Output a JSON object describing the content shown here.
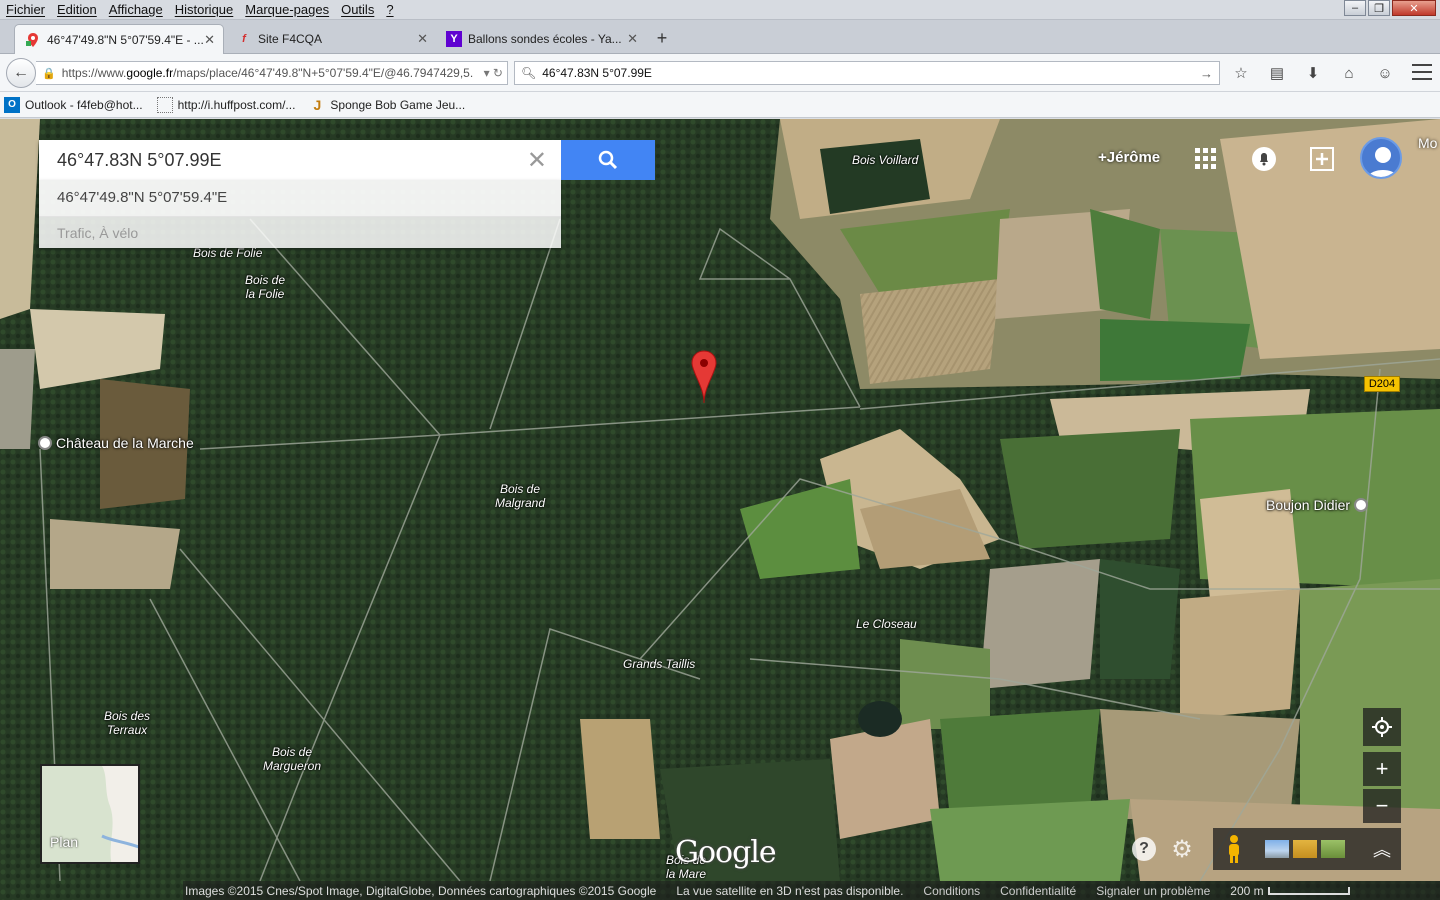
{
  "menubar": {
    "items": [
      "Fichier",
      "Edition",
      "Affichage",
      "Historique",
      "Marque-pages",
      "Outils",
      "?"
    ]
  },
  "tabs": [
    {
      "label": "46°47'49.8\"N 5°07'59.4\"E - ...",
      "icon": "google-maps-icon"
    },
    {
      "label": "Site F4CQA",
      "icon": "free-icon"
    },
    {
      "label": "Ballons sondes écoles - Ya...",
      "icon": "yahoo-icon"
    }
  ],
  "navbar": {
    "url_prefix": "https://www.",
    "url_domain": "google.fr",
    "url_path": "/maps/place/46°47'49.8\"N+5°07'59.4\"E/@46.7947429,5.",
    "search_value": "46°47.83N 5°07.99E"
  },
  "bookmarks": [
    {
      "label": "Outlook - f4feb@hot...",
      "icon": "outlook-icon"
    },
    {
      "label": "http://i.huffpost.com/...",
      "icon": "page-icon"
    },
    {
      "label": "Sponge Bob Game Jeu...",
      "icon": "jeu-icon"
    }
  ],
  "maps": {
    "search_value": "46°47.83N 5°07.99E",
    "suggestion_1": "46°47'49.8\"N 5°07'59.4\"E",
    "suggestion_2": "Trafic, À vélo",
    "account_link": "+Jérôme",
    "truncated_label": "Mo",
    "road_badge": "D204",
    "minimap_label": "Plan",
    "logo_text": "Google",
    "places": {
      "bois_voillard": "Bois Voillard",
      "bois_de_folie": "Bois de Folie",
      "bois_de_la_folie_1": "Bois de",
      "bois_de_la_folie_2": "la Folie",
      "bois_de_malgrand_1": "Bois de",
      "bois_de_malgrand_2": "Malgrand",
      "bois_des_terraux_1": "Bois des",
      "bois_des_terraux_2": "Terraux",
      "bois_de_margueron_1": "Bois de",
      "bois_de_margueron_2": "Margueron",
      "grands_taillis": "Grands Taillis",
      "le_closeau": "Le Closeau",
      "bois_de_la_mare_1": "Bois de",
      "bois_de_la_mare_2": "la Mare",
      "chateau": "Château de la Marche",
      "boujon": "Boujon Didier"
    },
    "footer": {
      "attribution": "Images ©2015 Cnes/Spot Image, DigitalGlobe, Données cartographiques ©2015 Google",
      "notice": "La vue satellite en 3D n'est pas disponible.",
      "conditions": "Conditions",
      "privacy": "Confidentialité",
      "report": "Signaler un problème",
      "scale": "200 m"
    }
  },
  "colors": {
    "forest": "#243522",
    "search_blue": "#4285f4",
    "pin_red": "#e53935",
    "road_yellow": "#f5c200"
  }
}
